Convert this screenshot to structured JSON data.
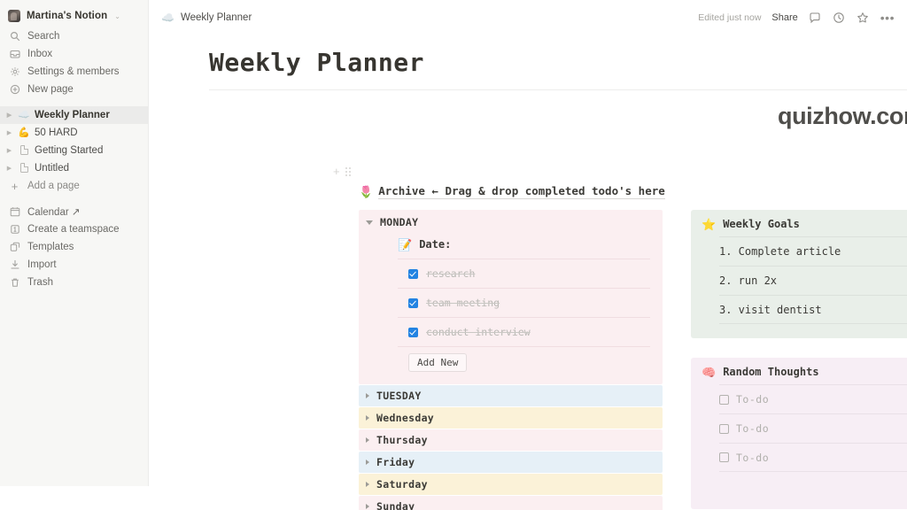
{
  "sidebar": {
    "workspace": {
      "name": "Martina's Notion",
      "caret": "chevron-down"
    },
    "nav": [
      {
        "icon": "search-icon",
        "label": "Search"
      },
      {
        "icon": "inbox-icon",
        "label": "Inbox"
      },
      {
        "icon": "gear-icon",
        "label": "Settings & members"
      },
      {
        "icon": "plus-circle-icon",
        "label": "New page"
      }
    ],
    "pages": [
      {
        "icon": "☁️",
        "label": "Weekly Planner",
        "active": true
      },
      {
        "icon": "💪",
        "label": "50 HARD",
        "active": false
      },
      {
        "icon": "doc",
        "label": "Getting Started",
        "active": false
      },
      {
        "icon": "doc",
        "label": "Untitled",
        "active": false
      }
    ],
    "add_page_label": "Add a page",
    "bottom": [
      {
        "icon": "calendar-icon",
        "label": "Calendar ↗"
      },
      {
        "icon": "teamspace-icon",
        "label": "Create a teamspace"
      },
      {
        "icon": "templates-icon",
        "label": "Templates"
      },
      {
        "icon": "import-icon",
        "label": "Import"
      },
      {
        "icon": "trash-icon",
        "label": "Trash"
      }
    ]
  },
  "topbar": {
    "breadcrumb_icon": "☁️",
    "breadcrumb": "Weekly Planner",
    "edited": "Edited just now",
    "share": "Share",
    "icons": [
      "comment-icon",
      "clock-icon",
      "star-icon",
      "more-icon"
    ]
  },
  "page": {
    "title": "Weekly Planner",
    "watermark": "quizhow.com",
    "archive": {
      "emoji": "🌷",
      "text": "Archive ← Drag & drop completed todo's here"
    }
  },
  "monday": {
    "label": "MONDAY",
    "date_emoji": "📝",
    "date_label": "Date:",
    "todos": [
      {
        "text": "research",
        "checked": true
      },
      {
        "text": "team meeting",
        "checked": true
      },
      {
        "text": "conduct interview",
        "checked": true
      }
    ],
    "add_new": "Add New"
  },
  "days": [
    {
      "label": "TUESDAY",
      "color": "#e6f0f7"
    },
    {
      "label": "Wednesday",
      "color": "#fbf2d8"
    },
    {
      "label": "Thursday",
      "color": "#fbeff1"
    },
    {
      "label": "Friday",
      "color": "#e6f0f7"
    },
    {
      "label": "Saturday",
      "color": "#fbf2d8"
    },
    {
      "label": "Sunday",
      "color": "#fbeff1"
    }
  ],
  "goals": {
    "emoji": "⭐",
    "title": "Weekly Goals",
    "items": [
      "1. Complete article",
      "2. run 2x",
      "3. visit dentist"
    ]
  },
  "thoughts": {
    "emoji": "🧠",
    "title": "Random Thoughts",
    "items": [
      "To-do",
      "To-do",
      "To-do"
    ]
  },
  "colors": {
    "accent_blue": "#2383e2",
    "monday_bg": "#fbeff1",
    "goals_bg": "#e9efe9",
    "thoughts_bg": "#f7eef5",
    "sidebar_bg": "#f7f7f5"
  }
}
